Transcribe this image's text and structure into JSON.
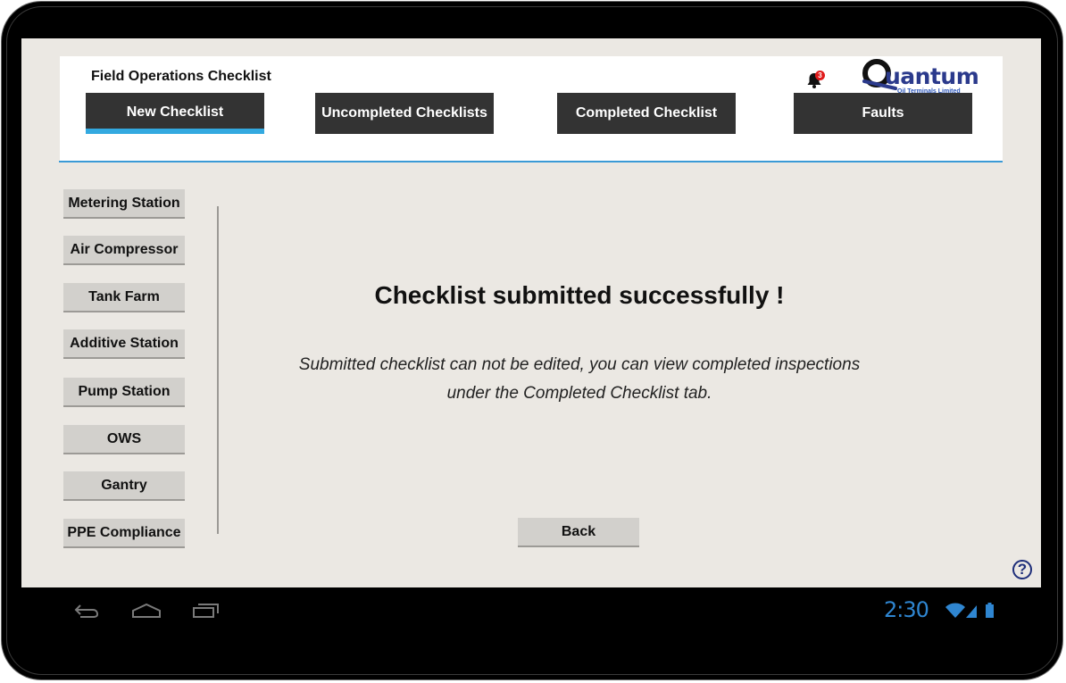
{
  "app": {
    "title": "Field Operations Checklist",
    "notification_count": "3",
    "logo_word": "uantum",
    "logo_subtitle": "Oil Terminals Limited"
  },
  "tabs": [
    {
      "label": "New Checklist",
      "active": true
    },
    {
      "label": "Uncompleted Checklists",
      "active": false
    },
    {
      "label": "Completed Checklist",
      "active": false
    },
    {
      "label": "Faults",
      "active": false
    }
  ],
  "sidebar": {
    "items": [
      {
        "label": "Metering Station"
      },
      {
        "label": "Air Compressor"
      },
      {
        "label": "Tank Farm"
      },
      {
        "label": "Additive Station"
      },
      {
        "label": "Pump Station"
      },
      {
        "label": "OWS"
      },
      {
        "label": "Gantry"
      },
      {
        "label": "PPE Compliance"
      }
    ]
  },
  "main": {
    "heading": "Checklist submitted successfully !",
    "message_line1": "Submitted checklist can not be edited, you can view completed inspections",
    "message_line2": "under the Completed Checklist tab.",
    "back_label": "Back"
  },
  "help": {
    "symbol": "?"
  },
  "system_bar": {
    "time": "2:30",
    "icons": [
      "back-icon",
      "home-icon",
      "recent-apps-icon",
      "wifi-icon",
      "signal-icon",
      "battery-icon"
    ]
  },
  "colors": {
    "accent": "#33a9e0",
    "tab_bg": "#333333",
    "screen_bg": "#ebe8e3",
    "badge": "#e01b1b",
    "clock": "#2f86d1"
  }
}
